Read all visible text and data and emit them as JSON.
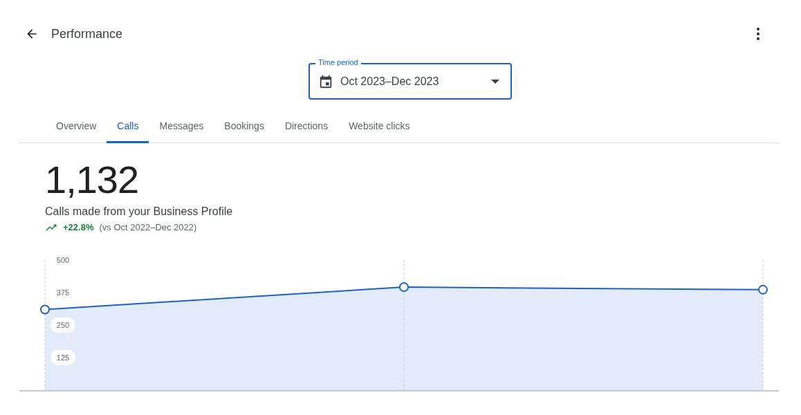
{
  "header": {
    "title": "Performance"
  },
  "time_period": {
    "label": "Time period",
    "value": "Oct 2023–Dec 2023"
  },
  "tabs": [
    {
      "label": "Overview",
      "selected": false
    },
    {
      "label": "Calls",
      "selected": true
    },
    {
      "label": "Messages",
      "selected": false
    },
    {
      "label": "Bookings",
      "selected": false
    },
    {
      "label": "Directions",
      "selected": false
    },
    {
      "label": "Website clicks",
      "selected": false
    }
  ],
  "metric": {
    "value": "1,132",
    "caption": "Calls made from your Business Profile",
    "change": "+22.8%",
    "comparison": "(vs Oct 2022–Dec 2022)"
  },
  "chart_data": {
    "type": "area",
    "ylim": [
      0,
      500
    ],
    "yticks": [
      125,
      250,
      375,
      500
    ],
    "series": [
      {
        "color": "#1a62c8",
        "values": [
          310,
          396,
          386
        ]
      }
    ]
  }
}
